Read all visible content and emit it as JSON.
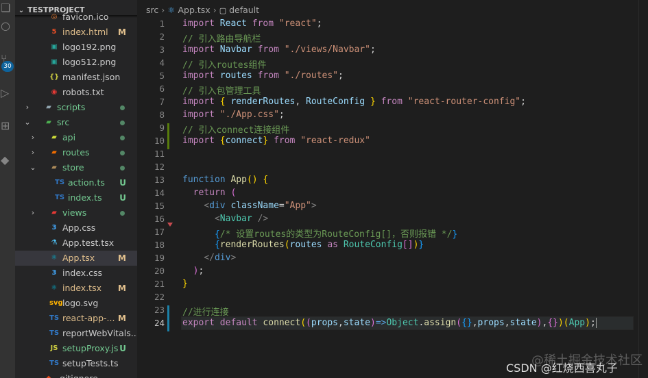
{
  "explorer": {
    "project": "TESTPROJECT",
    "items": [
      {
        "name": "favicon.ico",
        "icon": "favicon-icon",
        "status": ""
      },
      {
        "name": "index.html",
        "icon": "html5-icon",
        "status": "M"
      },
      {
        "name": "logo192.png",
        "icon": "image-icon",
        "status": ""
      },
      {
        "name": "logo512.png",
        "icon": "image-icon",
        "status": ""
      },
      {
        "name": "manifest.json",
        "icon": "json-icon",
        "status": ""
      },
      {
        "name": "robots.txt",
        "icon": "robots-icon",
        "status": ""
      },
      {
        "name": "scripts",
        "icon": "folder-icon",
        "status": "dot"
      },
      {
        "name": "src",
        "icon": "folder-src-icon",
        "status": "dot"
      },
      {
        "name": "api",
        "icon": "folder-api-icon",
        "status": "dot"
      },
      {
        "name": "routes",
        "icon": "folder-routes-icon",
        "status": "dot"
      },
      {
        "name": "store",
        "icon": "folder-store-icon",
        "status": "dot"
      },
      {
        "name": "action.ts",
        "icon": "ts-icon",
        "status": "U"
      },
      {
        "name": "index.ts",
        "icon": "ts-icon",
        "status": "U"
      },
      {
        "name": "views",
        "icon": "folder-views-icon",
        "status": "dot"
      },
      {
        "name": "App.css",
        "icon": "css-icon",
        "status": ""
      },
      {
        "name": "App.test.tsx",
        "icon": "test-icon",
        "status": ""
      },
      {
        "name": "App.tsx",
        "icon": "react-icon",
        "status": "M"
      },
      {
        "name": "index.css",
        "icon": "css-icon",
        "status": ""
      },
      {
        "name": "index.tsx",
        "icon": "react-icon",
        "status": "M"
      },
      {
        "name": "logo.svg",
        "icon": "svg-icon",
        "status": ""
      },
      {
        "name": "react-app-...",
        "icon": "ts-icon",
        "status": "M"
      },
      {
        "name": "reportWebVitals....",
        "icon": "ts-icon",
        "status": ""
      },
      {
        "name": "setupProxy.js",
        "icon": "js-icon",
        "status": "U"
      },
      {
        "name": "setupTests.ts",
        "icon": "ts-icon",
        "status": ""
      },
      {
        "name": ".gitignore",
        "icon": "git-icon",
        "status": ""
      }
    ]
  },
  "activity_badge": "30",
  "breadcrumb": {
    "folder": "src",
    "file": "App.tsx",
    "symbol": "default"
  },
  "code": {
    "line_numbers": [
      "1",
      "2",
      "3",
      "4",
      "5",
      "6",
      "7",
      "8",
      "9",
      "10",
      "11",
      "12",
      "13",
      "14",
      "15",
      "16",
      "17",
      "18",
      "19",
      "20",
      "21",
      "22",
      "23",
      "24"
    ],
    "current_line": "24",
    "strings": {
      "s_react": "\"react\"",
      "c_nav": "// 引入路由导航栏",
      "s_navbar": "\"./views/Navbar\"",
      "c_routes": "// 引入routes组件",
      "s_routes": "\"./routes\"",
      "c_pkg": "// 引入包管理工具",
      "s_rrc": "\"react-router-config\"",
      "s_css": "\"./App.css\"",
      "c_connect": "// 引入connect连接组件",
      "s_redux": "\"react-redux\"",
      "s_app": "\"App\"",
      "c_jsx": "/* 设置routes的类型为RouteConfig[]，否则报错 */",
      "c_connect2": "//进行连接"
    }
  },
  "watermark": {
    "primary": "CSDN @红烧西喜丸子",
    "secondary": "@稀土掘金技术社区"
  },
  "colors": {
    "background": "#1e1e1e",
    "sidebar": "#252526",
    "modified": "#e2c08d",
    "untracked": "#73c991",
    "selection": "#37373d"
  }
}
